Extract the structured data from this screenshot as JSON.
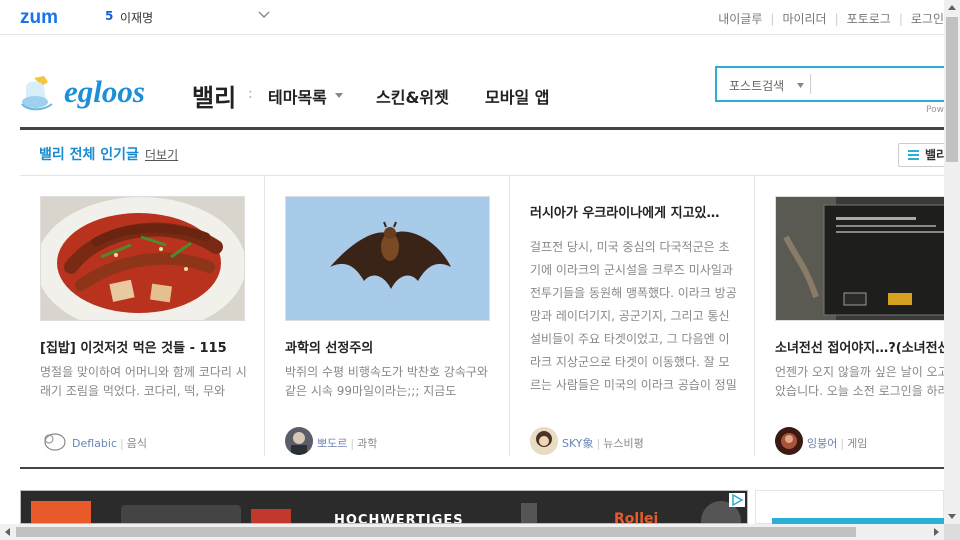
{
  "topbar": {
    "logo": "zum",
    "rank_number": "5",
    "rank_keyword": "이재명",
    "links": [
      "내이글루",
      "마이리더",
      "포토로그",
      "로그인"
    ]
  },
  "header": {
    "logo_text": "egloos",
    "title": "밸리",
    "separator": ":",
    "nav": {
      "theme": "테마목록",
      "skin": "스킨&위젯",
      "mobile": "모바일 앱"
    },
    "search": {
      "select_label": "포스트검색",
      "input_value": ""
    },
    "powered_text": "Pow"
  },
  "popular": {
    "title": "밸리 전체 인기글",
    "more": "더보기",
    "valley_button": "밸리"
  },
  "cards": [
    {
      "title": "[집밥] 이것저것 먹은 것들 - 115",
      "body": "명절을 맞이하여 어머니와 함께 코다리 시래기 조림을 먹었다. 코다리, 떡, 무와",
      "author": "Deflabic",
      "category": "음식"
    },
    {
      "title": "과학의 선정주의",
      "body": "박쥐의 수평 비행속도가 박찬호 강속구와 같은 시속 99마일이라는;;; 지금도",
      "author": "뽀도르",
      "category": "과학"
    },
    {
      "title": "러시아가 우크라이나에게 지고있…",
      "body": "걸프전 당시, 미국 중심의 다국적군은 초기에 이라크의 군시설을 크루즈 미사일과 전투기들을 동원해 맹폭했다. 이라크 방공망과 레이더기지, 공군기지, 그리고 통신설비들이 주요 타겟이었고, 그 다음엔 이라크 지상군으로 타겟이 이동했다. 잘 모르는 사람들은 미국의 이라크 공습이 정밀폭격으로 매우 손쉽",
      "author": "SKY象",
      "category": "뉴스비평"
    },
    {
      "title": "소녀전선 접어야지…?(소녀전선",
      "body": "언젠가 오지 않을까 싶은 날이 오고 말았습니다. 오늘 소전 로그인을 하려",
      "author": "잉붕어",
      "category": "게임"
    }
  ],
  "ad": {
    "headline": "HOCHWERTIGES",
    "brand": "Rollei"
  },
  "icons": {
    "zum_color": "#1a73e8",
    "accent": "#2bafd7",
    "egloos_blue": "#1c8fd6"
  }
}
